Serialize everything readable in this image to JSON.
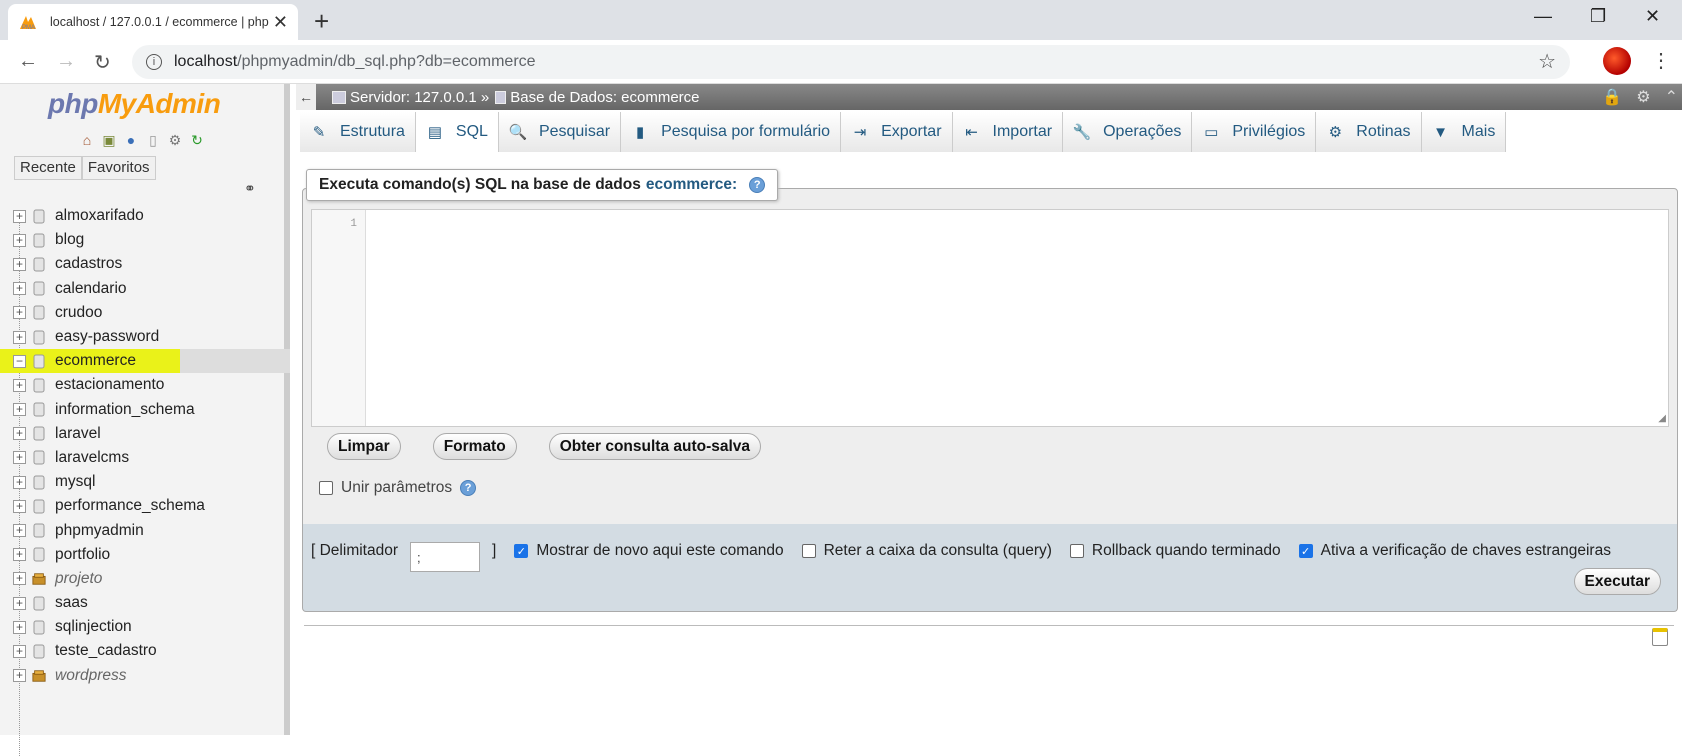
{
  "browser": {
    "tab_title": "localhost / 127.0.0.1 / ecommerce | php",
    "new_tab": "+",
    "url_host": "localhost",
    "url_path": "/phpmyadmin/db_sql.php?db=ecommerce",
    "window_controls": [
      "—",
      "❐",
      "✕"
    ]
  },
  "nav": {
    "logo_php": "php",
    "logo_myadmin": "MyAdmin",
    "recent_label": "Recente",
    "favorites_label": "Favoritos",
    "databases": [
      {
        "name": "almoxarifado",
        "italic": false
      },
      {
        "name": "blog",
        "italic": false
      },
      {
        "name": "cadastros",
        "italic": false
      },
      {
        "name": "calendario",
        "italic": false
      },
      {
        "name": "crudoo",
        "italic": false
      },
      {
        "name": "easy-password",
        "italic": false
      },
      {
        "name": "ecommerce",
        "italic": false,
        "selected": true
      },
      {
        "name": "estacionamento",
        "italic": false
      },
      {
        "name": "information_schema",
        "italic": false
      },
      {
        "name": "laravel",
        "italic": false
      },
      {
        "name": "laravelcms",
        "italic": false
      },
      {
        "name": "mysql",
        "italic": false
      },
      {
        "name": "performance_schema",
        "italic": false
      },
      {
        "name": "phpmyadmin",
        "italic": false
      },
      {
        "name": "portfolio",
        "italic": false
      },
      {
        "name": "projeto",
        "italic": true
      },
      {
        "name": "saas",
        "italic": false
      },
      {
        "name": "sqlinjection",
        "italic": false
      },
      {
        "name": "teste_cadastro",
        "italic": false
      },
      {
        "name": "wordpress",
        "italic": true
      }
    ]
  },
  "serverbar": {
    "server": "Servidor: 127.0.0.1 »",
    "database": "Base de Dados: ecommerce"
  },
  "tabs": [
    {
      "label": "Estrutura",
      "icon": "structure-icon",
      "glyph": "✎"
    },
    {
      "label": "SQL",
      "icon": "sql-icon",
      "glyph": "▤",
      "active": true
    },
    {
      "label": "Pesquisar",
      "icon": "search-icon",
      "glyph": "🔍"
    },
    {
      "label": "Pesquisa por formulário",
      "icon": "query-icon",
      "glyph": "▮"
    },
    {
      "label": "Exportar",
      "icon": "export-icon",
      "glyph": "⇥"
    },
    {
      "label": "Importar",
      "icon": "import-icon",
      "glyph": "⇤"
    },
    {
      "label": "Operações",
      "icon": "wrench-icon",
      "glyph": "🔧"
    },
    {
      "label": "Privilégios",
      "icon": "privileges-icon",
      "glyph": "▭"
    },
    {
      "label": "Rotinas",
      "icon": "routines-icon",
      "glyph": "⚙"
    },
    {
      "label": "Mais",
      "icon": "more-icon",
      "glyph": "▼"
    }
  ],
  "sql": {
    "legend_text": "Executa comando(s) SQL na base de dados",
    "legend_db": "ecommerce:",
    "line_number": "1",
    "btn_clear": "Limpar",
    "btn_format": "Formato",
    "btn_autosaved": "Obter consulta auto-salva",
    "bind_params": "Unir parâmetros"
  },
  "options": {
    "delimiter_label": "[ Delimitador",
    "delimiter_value": ";",
    "delimiter_close": "]",
    "show_again": "Mostrar de novo aqui este comando",
    "retain": "Reter a caixa da consulta (query)",
    "rollback": "Rollback quando terminado",
    "fk_check": "Ativa a verificação de chaves estrangeiras",
    "execute": "Executar"
  }
}
